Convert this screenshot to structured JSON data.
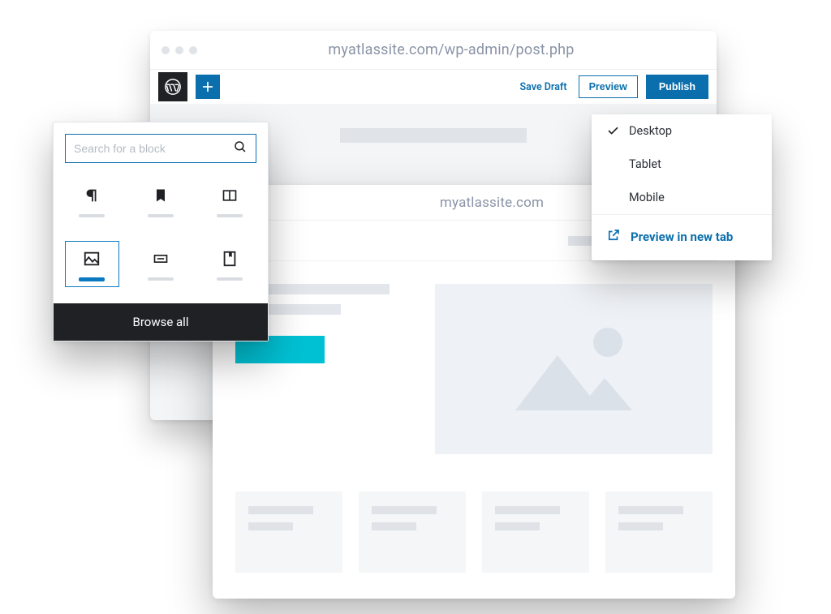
{
  "editor": {
    "address": "myatlassite.com/wp-admin/post.php",
    "toolbar": {
      "save_draft": "Save Draft",
      "preview": "Preview",
      "publish": "Publish"
    }
  },
  "inserter": {
    "search_placeholder": "Search for a block",
    "blocks": [
      {
        "icon": "paragraph-icon",
        "selected": false
      },
      {
        "icon": "bookmark-icon",
        "selected": false
      },
      {
        "icon": "columns-icon",
        "selected": false
      },
      {
        "icon": "image-icon",
        "selected": true
      },
      {
        "icon": "separator-icon",
        "selected": false
      },
      {
        "icon": "book-icon",
        "selected": false
      }
    ],
    "browse_all": "Browse all"
  },
  "preview_menu": {
    "options": [
      {
        "label": "Desktop",
        "checked": true
      },
      {
        "label": "Tablet",
        "checked": false
      },
      {
        "label": "Mobile",
        "checked": false
      }
    ],
    "new_tab": "Preview in new tab"
  },
  "preview_site": {
    "address": "myatlassite.com"
  }
}
